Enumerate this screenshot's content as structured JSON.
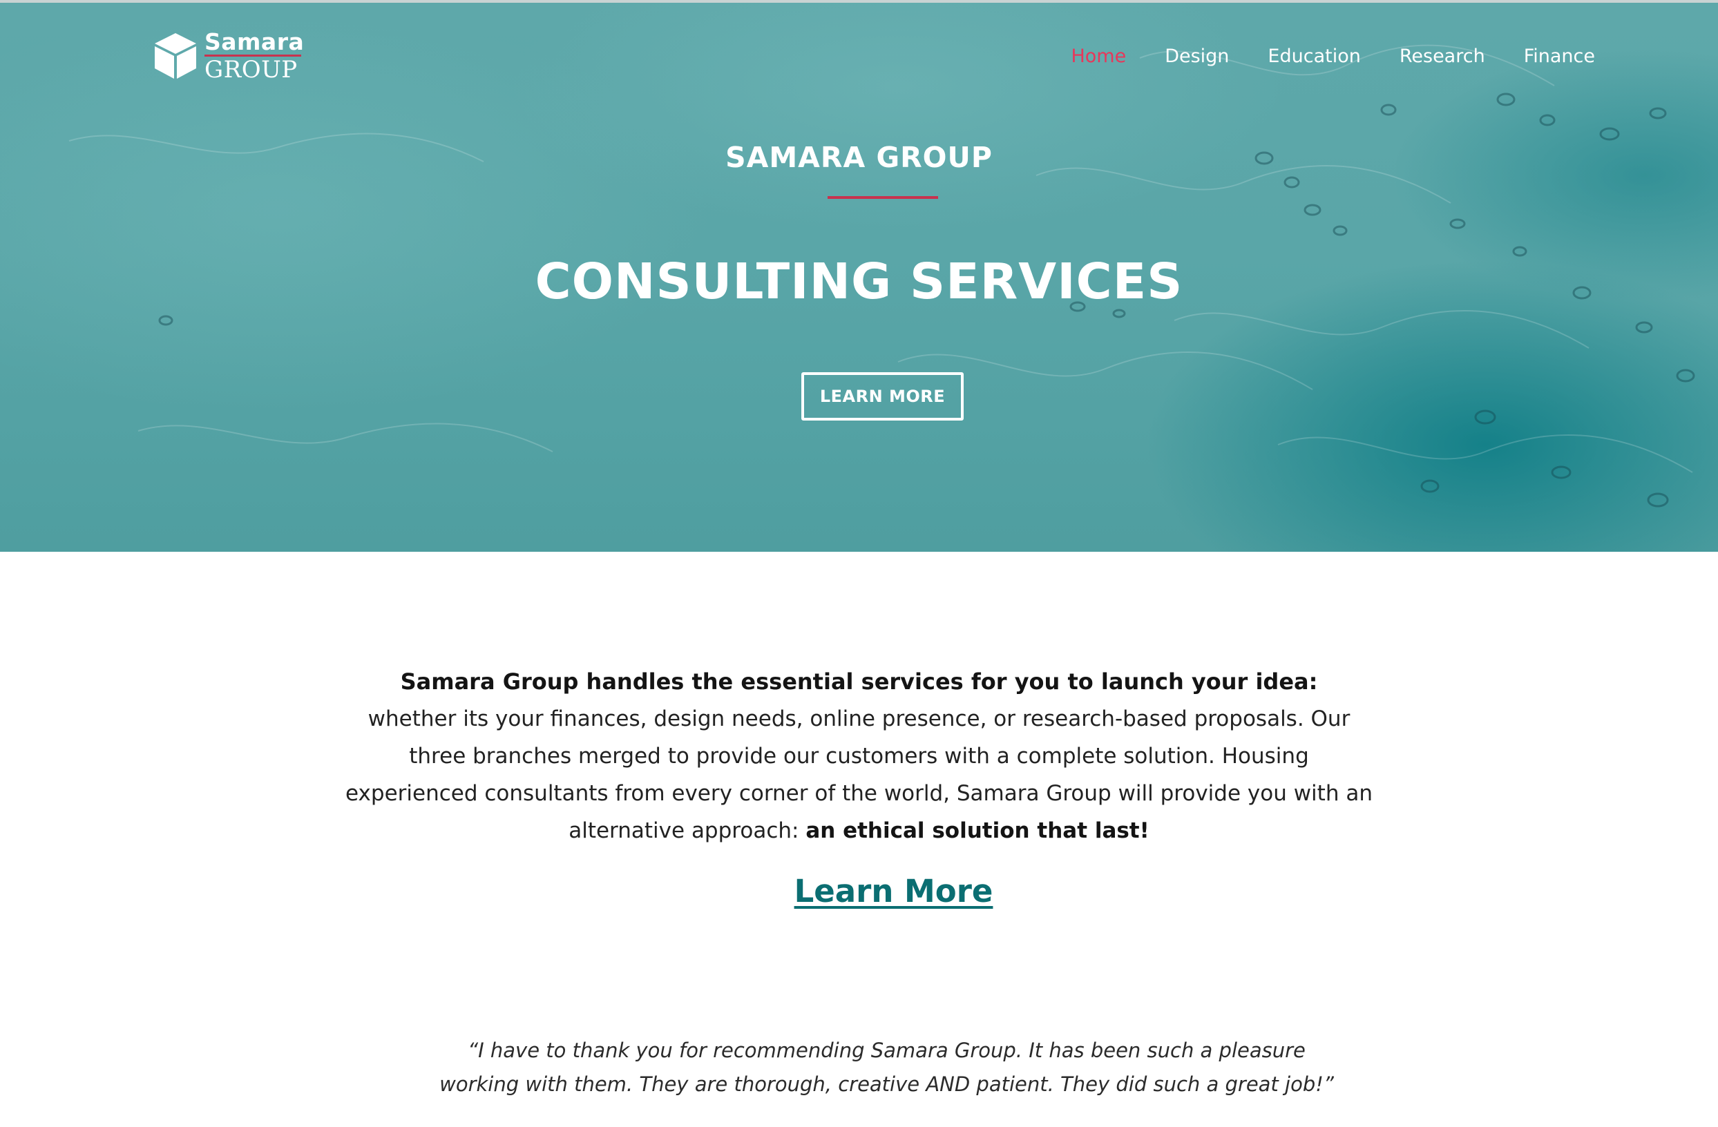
{
  "brand": {
    "logo_top": "Samara",
    "logo_bottom": "GROUP",
    "accent_color": "#e8375a",
    "teal_color": "#5ea8aa",
    "link_color": "#0b6e72"
  },
  "nav": {
    "items": [
      {
        "label": "Home",
        "active": true
      },
      {
        "label": "Design",
        "active": false
      },
      {
        "label": "Education",
        "active": false
      },
      {
        "label": "Research",
        "active": false
      },
      {
        "label": "Finance",
        "active": false
      }
    ]
  },
  "hero": {
    "kicker": "SAMARA GROUP",
    "title": "CONSULTING SERVICES",
    "button_label": "LEARN MORE"
  },
  "intro": {
    "lead": "Samara Group handles the essential services for you to launch your idea:",
    "body": "whether its your finances, design needs, online presence, or research-based proposals.  Our three branches merged to provide our customers with a complete solution. Housing experienced consultants from every corner of the world, Samara Group will provide you with an alternative approach: ",
    "body_emphasis": "an ethical solution that last!"
  },
  "learn_more_link": "Learn More",
  "testimonial": {
    "quote": "“I have to thank you for recommending Samara Group. It has been such a pleasure working with them. They are thorough, creative AND patient. They did such a great job!”"
  },
  "icons": {
    "logo": "cube-icon"
  }
}
